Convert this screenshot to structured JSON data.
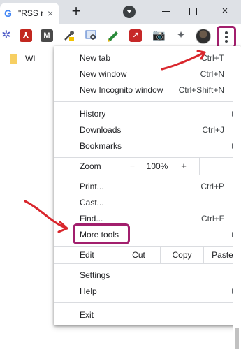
{
  "tab": {
    "icon": "google-g-icon",
    "title": "\"RSS r",
    "close_glyph": "×"
  },
  "newtab_glyph": "+",
  "window_controls": {
    "close_glyph": "×"
  },
  "bookmarks": [
    {
      "label": "WL"
    }
  ],
  "menu": {
    "new_tab": {
      "label": "New tab",
      "shortcut": "Ctrl+T"
    },
    "new_window": {
      "label": "New window",
      "shortcut": "Ctrl+N"
    },
    "new_incognito": {
      "label": "New Incognito window",
      "shortcut": "Ctrl+Shift+N"
    },
    "history": {
      "label": "History"
    },
    "downloads": {
      "label": "Downloads",
      "shortcut": "Ctrl+J"
    },
    "bookmarks": {
      "label": "Bookmarks"
    },
    "zoom": {
      "label": "Zoom",
      "minus": "−",
      "value": "100%",
      "plus": "+"
    },
    "print": {
      "label": "Print...",
      "shortcut": "Ctrl+P"
    },
    "cast": {
      "label": "Cast..."
    },
    "find": {
      "label": "Find...",
      "shortcut": "Ctrl+F"
    },
    "more_tools": {
      "label": "More tools"
    },
    "edit": {
      "label": "Edit",
      "cut": "Cut",
      "copy": "Copy",
      "paste": "Paste"
    },
    "settings": {
      "label": "Settings"
    },
    "help": {
      "label": "Help"
    },
    "exit": {
      "label": "Exit"
    }
  },
  "colors": {
    "annotation": "#a21f6d",
    "arrow": "#d9262c",
    "tabstrip": "#dee1e6"
  }
}
